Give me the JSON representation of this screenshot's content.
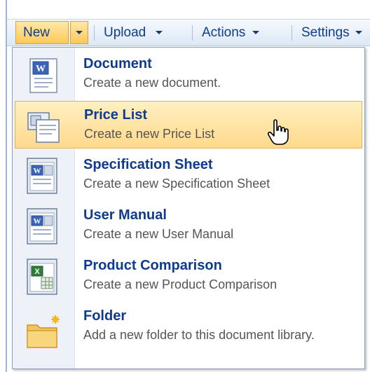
{
  "toolbar": {
    "new_label": "New",
    "upload_label": "Upload",
    "actions_label": "Actions",
    "settings_label": "Settings"
  },
  "menu": {
    "items": [
      {
        "title": "Document",
        "description": "Create a new document.",
        "icon": "word-document-icon"
      },
      {
        "title": "Price List",
        "description": "Create a new Price List",
        "icon": "price-list-icon"
      },
      {
        "title": "Specification Sheet",
        "description": "Create a new Specification Sheet",
        "icon": "word-template-icon"
      },
      {
        "title": "User Manual",
        "description": "Create a new User Manual",
        "icon": "word-template-icon"
      },
      {
        "title": "Product Comparison",
        "description": "Create a new Product Comparison",
        "icon": "excel-template-icon"
      },
      {
        "title": "Folder",
        "description": "Add a new folder to this document library.",
        "icon": "new-folder-icon"
      }
    ],
    "highlighted_index": 1
  },
  "colors": {
    "accent_text": "#0f3a8e",
    "highlight_top": "#fff0c2",
    "highlight_bottom": "#ffd98c"
  }
}
